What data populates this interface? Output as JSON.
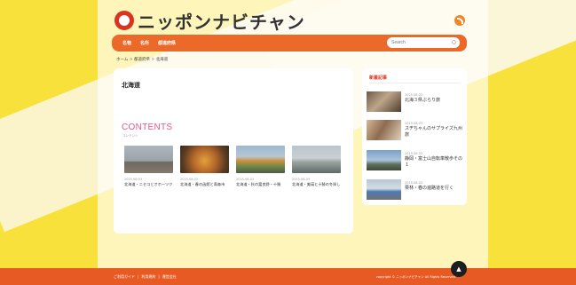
{
  "site": {
    "logo_text": "ニッポンナビチャン",
    "accent_colors": {
      "brand_red": "#d8341f",
      "nav_orange": "#eb6a2a",
      "footer_orange": "#e85a24",
      "contents_pink": "#e8558c",
      "background_yellow": "#f8e13a"
    }
  },
  "header": {
    "rss_icon": "rss-icon",
    "nav": [
      {
        "label": "名物"
      },
      {
        "label": "名所"
      },
      {
        "label": "都道府県"
      }
    ],
    "search": {
      "placeholder": "Search",
      "icon": "search-icon"
    }
  },
  "breadcrumb": [
    {
      "label": "ホーム"
    },
    {
      "label": ">"
    },
    {
      "label": "都道府県"
    },
    {
      "label": ">"
    },
    {
      "label": "北海道"
    }
  ],
  "main": {
    "page_title": "北海道",
    "contents_heading": "CONTENTS",
    "contents_subheading": "コンテンツ",
    "posts": [
      {
        "date": "2015.08.03",
        "title": "北海道・ニセコとオホーツク"
      },
      {
        "date": "2015.08.03",
        "title": "北海道・春の函館と青森市"
      },
      {
        "date": "2015.08.03",
        "title": "北海道・秋の富良野・十勝"
      },
      {
        "date": "2015.08.03",
        "title": "北海道・美瑛と十勝の冬探し"
      }
    ]
  },
  "sidebar": {
    "heading": "新着記事",
    "items": [
      {
        "date": "2015.08.03",
        "title": "北海３県ぶらり旅"
      },
      {
        "date": "2015.08.03",
        "title": "スヂちゃんのサプライズ九州旅"
      },
      {
        "date": "2015.08.03",
        "title": "静岡・富士山自転車散歩その１"
      },
      {
        "date": "2015.08.03",
        "title": "栗林・春の遍路道を行く"
      }
    ]
  },
  "footer": {
    "links": [
      {
        "label": "ご利用ガイド"
      },
      {
        "label": "|"
      },
      {
        "label": "利用規約"
      },
      {
        "label": "|"
      },
      {
        "label": "運営会社"
      }
    ],
    "copyright": "copyright © ニッポンナビチャン All Rights Reserved.",
    "top_button_label": "▲"
  }
}
